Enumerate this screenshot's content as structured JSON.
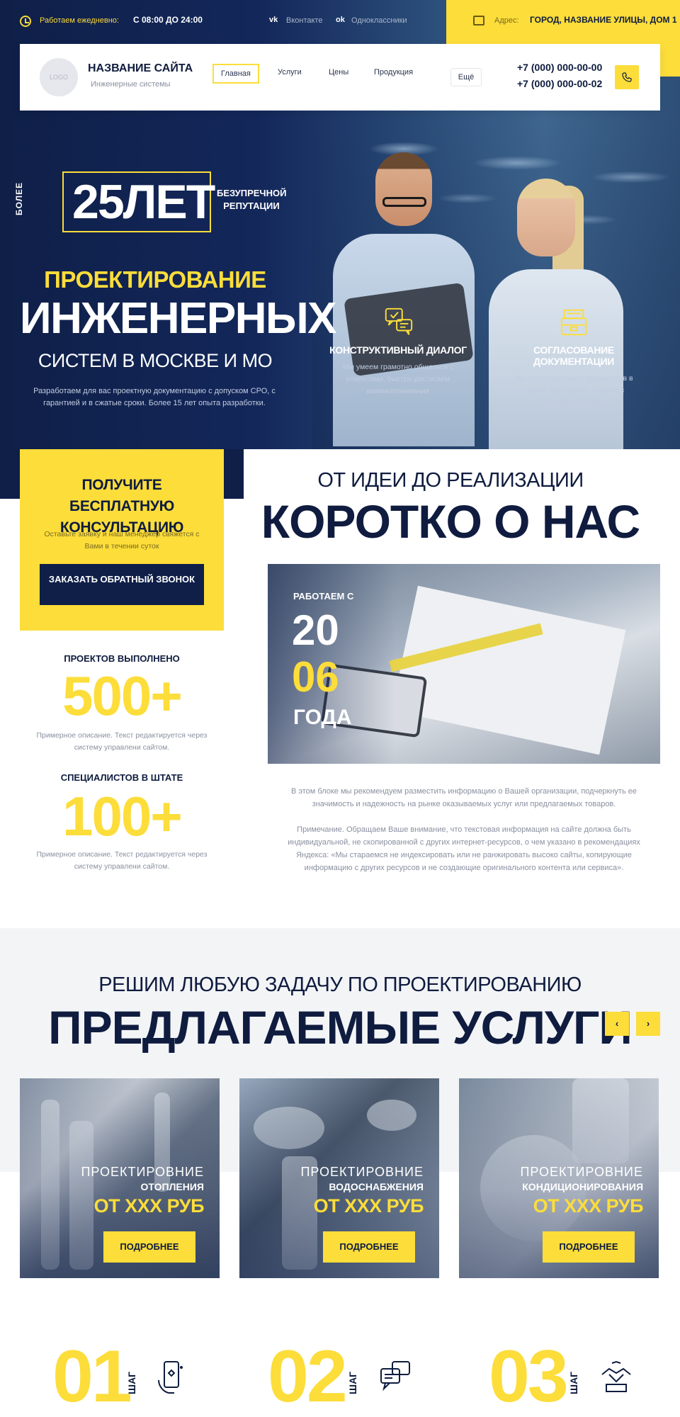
{
  "topbar": {
    "hours_label": "Работаем ежедневно:",
    "hours_value": "С 08:00 ДО 24:00",
    "social": [
      {
        "icon": "vk-icon",
        "icon_glyph": "vk",
        "label": "Вконтакте"
      },
      {
        "icon": "odnoklassniki-icon",
        "icon_glyph": "ok",
        "label": "Одноклассники"
      }
    ],
    "address_label": "Адрес:",
    "address_value": "ГОРОД, НАЗВАНИЕ УЛИЦЫ, ДОМ 1"
  },
  "header": {
    "logo_text": "LOGO",
    "site_name": "НАЗВАНИЕ САЙТА",
    "site_sub": "Инженерные системы",
    "nav": [
      "Главная",
      "Услуги",
      "Цены",
      "Продукция"
    ],
    "nav_active": "Главная",
    "nav_more": "Ещё",
    "phone1": "+7 (000) 000-00-00",
    "phone2": "+7 (000) 000-00-02",
    "call_icon": "phone-icon"
  },
  "hero": {
    "side_label": "БОЛЕЕ",
    "years": "25ЛЕТ",
    "years_caption": "БЕЗУПРЕЧНОЙ РЕПУТАЦИИ",
    "pre_title": "ПРОЕКТИРОВАНИЕ",
    "title": "ИНЖЕНЕРНЫХ",
    "subtitle": "СИСТЕМ В МОСКВЕ И МО",
    "description": "Разработаем для вас проектную документацию с допуском СРО, с гарантией и в сжатые сроки. Более 15 лет опыта разработки.",
    "features": [
      {
        "icon": "dialog-icon",
        "title": "КОНСТРУКТИВНЫЙ ДИАЛОГ",
        "desc": "Мы умеем грамотно общаться с клиентами, быстро достигаем взаимопонимания"
      },
      {
        "icon": "documents-icon",
        "title": "СОГЛАСОВАНИЕ ДОКУМЕНТАЦИИ",
        "desc": "Мы согласуем пакет документов в любых инстанциях, а также с подрядчиками"
      }
    ]
  },
  "consult": {
    "title": "ПОЛУЧИТЕ БЕСПЛАТНУЮ КОНСУЛЬТАЦИЮ",
    "desc": "Оставьте заявку и наш менеджер свяжется с Вами в течении суток",
    "button": "ЗАКАЗАТЬ ОБРАТНЫЙ ЗВОНОК"
  },
  "stats": [
    {
      "label": "ПРОЕКТОВ ВЫПОЛНЕНО",
      "value": "500+",
      "desc": "Примерное описание. Текст редактируется через систему управлени сайтом."
    },
    {
      "label": "СПЕЦИАЛИСТОВ В ШТАТЕ",
      "value": "100+",
      "desc": "Примерное описание. Текст редактируется через систему управлени сайтом."
    }
  ],
  "about": {
    "pre_title": "ОТ ИДЕИ ДО РЕАЛИЗАЦИИ",
    "title": "КОРОТКО О НАС",
    "since_label": "РАБОТАЕМ С",
    "since_year_1": "20",
    "since_year_2": "06",
    "since_tail": "ГОДА",
    "p1": "В этом блоке мы рекомендуем разместить информацию о Вашей организации, подчеркнуть ее значимость и надежность на рынке оказываемых услуг или предлагаемых товаров.",
    "p2": "Примечание. Обращаем Ваше внимание, что текстовая информация на сайте должна быть индивидуальной, не скопированной с других интернет-ресурсов, о чем указано в рекомендациях Яндекса: «Мы стараемся не индексировать или не ранжировать высоко сайты, копирующие информацию с других ресурсов и не создающие оригинального контента или сервиса»."
  },
  "services": {
    "pre_title": "РЕШИМ ЛЮБУЮ ЗАДАЧУ ПО ПРОЕКТИРОВАНИЮ",
    "title": "ПРЕДЛАГАЕМЫЕ УСЛУГИ",
    "prev": "‹",
    "next": "›",
    "cards": [
      {
        "pre": "ПРОЕКТИРОВНИЕ",
        "name": "ОТОПЛЕНИЯ",
        "price": "ОТ XXX РУБ",
        "button": "ПОДРОБНЕЕ"
      },
      {
        "pre": "ПРОЕКТИРОВНИЕ",
        "name": "ВОДОСНАБЖЕНИЯ",
        "price": "ОТ XXX РУБ",
        "button": "ПОДРОБНЕЕ"
      },
      {
        "pre": "ПРОЕКТИРОВНИЕ",
        "name": "КОНДИЦИОНИРОВАНИЯ",
        "price": "ОТ XXX РУБ",
        "button": "ПОДРОБНЕЕ"
      }
    ]
  },
  "steps": [
    {
      "num": "01",
      "word": "ШАГ",
      "icon": "phone-hand-icon"
    },
    {
      "num": "02",
      "word": "ШАГ",
      "icon": "chat-icon"
    },
    {
      "num": "03",
      "word": "ШАГ",
      "icon": "handshake-icon"
    }
  ],
  "colors": {
    "accent": "#fcdd3a",
    "navy": "#0f1f48",
    "text_muted": "#8a90a0"
  }
}
